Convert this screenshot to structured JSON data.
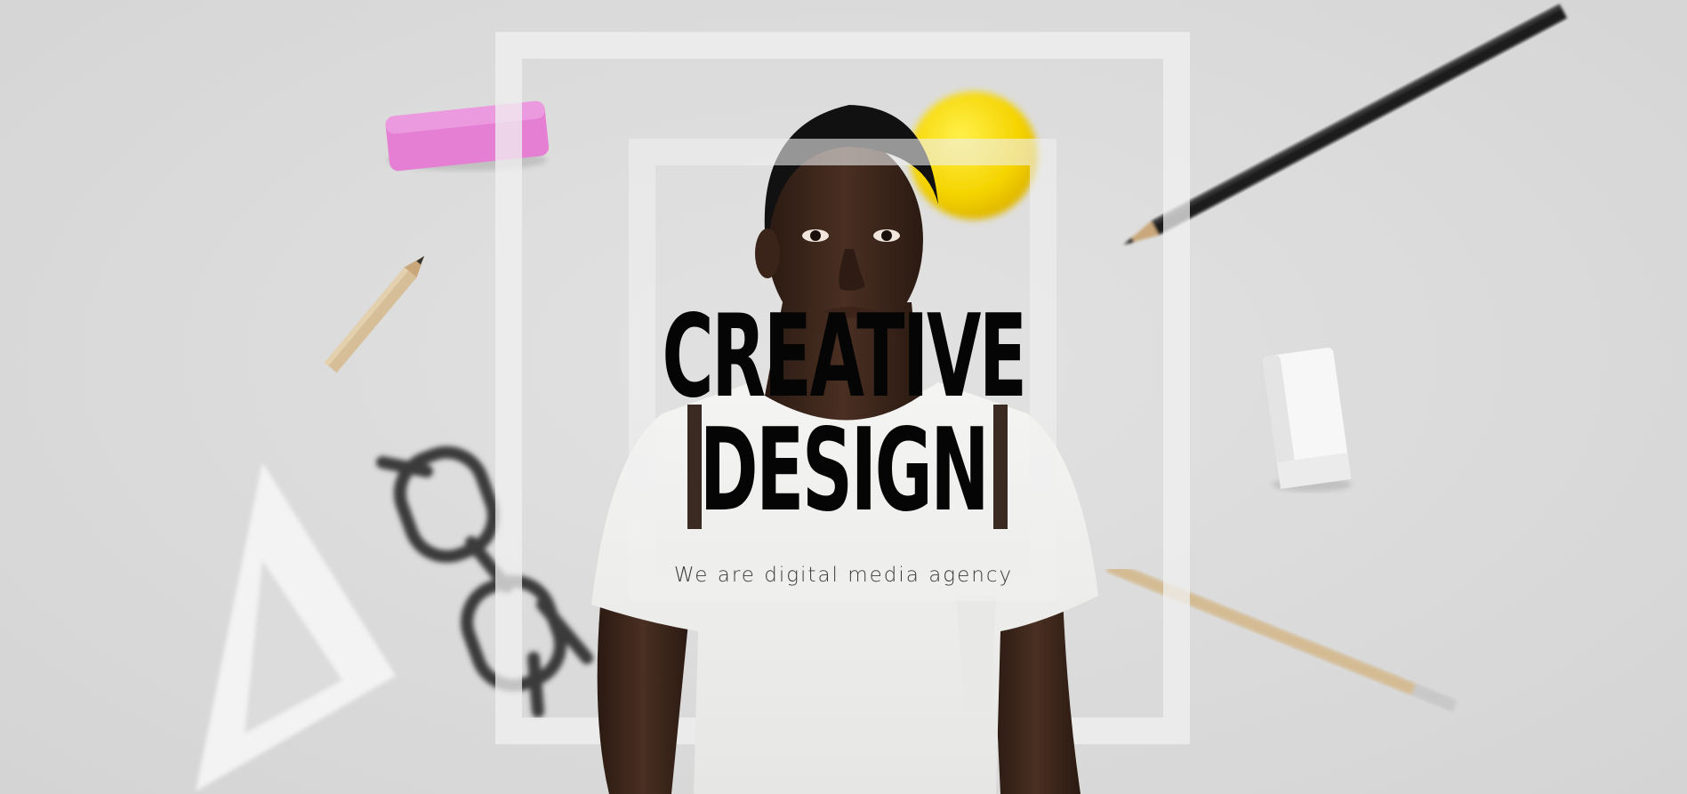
{
  "hero": {
    "title_line1": "CREATIVE",
    "title_line2": "DESIGN",
    "subtitle": "We are digital media agency"
  },
  "colors": {
    "background": "#dcdcdc",
    "title": "#050505",
    "subtitle": "#3a3a3a",
    "eraser_pink": "#e57fd3",
    "ball_yellow": "#f5d400"
  },
  "icons": [
    "pink-eraser",
    "pencil",
    "glasses",
    "triangle-ruler",
    "white-eraser",
    "yellow-ball",
    "black-pencil"
  ]
}
